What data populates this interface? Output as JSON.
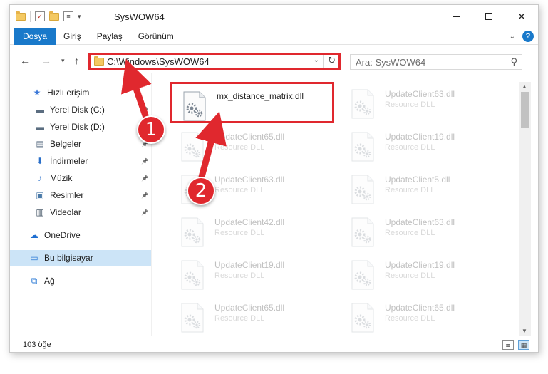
{
  "titlebar": {
    "title": "SysWOW64",
    "minimize": "—",
    "maximize": "☐",
    "close": "✕"
  },
  "ribbon": {
    "tabs": [
      "Dosya",
      "Giriş",
      "Paylaş",
      "Görünüm"
    ]
  },
  "navigation": {
    "back": "←",
    "forward": "→",
    "recent": "▾",
    "up": "↑",
    "address": "C:\\Windows\\SysWOW64",
    "address_chevron": "⌄",
    "refresh": "↻",
    "search_placeholder": "Ara: SysWOW64",
    "search_glyph": "⚲"
  },
  "sidebar": {
    "items": [
      {
        "label": "Hızlı erişim",
        "icon": "star-icon",
        "glyph": "★",
        "color": "#3b78d8"
      },
      {
        "label": "Yerel Disk (C:)",
        "icon": "drive-icon",
        "glyph": "▬",
        "color": "#5b6d80"
      },
      {
        "label": "Yerel Disk (D:)",
        "icon": "drive-icon",
        "glyph": "▬",
        "color": "#5b6d80"
      },
      {
        "label": "Belgeler",
        "icon": "documents-icon",
        "glyph": "▤",
        "color": "#6b7c8f"
      },
      {
        "label": "İndirmeler",
        "icon": "downloads-icon",
        "glyph": "⬇",
        "color": "#2a6fc9"
      },
      {
        "label": "Müzik",
        "icon": "music-icon",
        "glyph": "♪",
        "color": "#2a6fc9"
      },
      {
        "label": "Resimler",
        "icon": "pictures-icon",
        "glyph": "▣",
        "color": "#4a7aa8"
      },
      {
        "label": "Videolar",
        "icon": "videos-icon",
        "glyph": "▥",
        "color": "#4a5a6a"
      },
      {
        "label": "OneDrive",
        "icon": "cloud-icon",
        "glyph": "☁",
        "color": "#1c6dd0"
      },
      {
        "label": "Bu bilgisayar",
        "icon": "computer-icon",
        "glyph": "▭",
        "color": "#2b7ad6"
      },
      {
        "label": "Ağ",
        "icon": "network-icon",
        "glyph": "⧉",
        "color": "#2b7ad6"
      }
    ],
    "pin_glyph": "📌"
  },
  "files": [
    {
      "name": "mx_distance_matrix.dll",
      "desc": ""
    },
    {
      "name": "UpdateClient63.dll",
      "desc": "Resource DLL"
    },
    {
      "name": "UpdateClient65.dll",
      "desc": "Resource DLL"
    },
    {
      "name": "UpdateClient19.dll",
      "desc": "Resource DLL"
    },
    {
      "name": "UpdateClient63.dll",
      "desc": "Resource DLL"
    },
    {
      "name": "UpdateClient5.dll",
      "desc": "Resource DLL"
    },
    {
      "name": "UpdateClient42.dll",
      "desc": "Resource DLL"
    },
    {
      "name": "UpdateClient63.dll",
      "desc": "Resource DLL"
    },
    {
      "name": "UpdateClient19.dll",
      "desc": "Resource DLL"
    },
    {
      "name": "UpdateClient19.dll",
      "desc": "Resource DLL"
    },
    {
      "name": "UpdateClient65.dll",
      "desc": "Resource DLL"
    },
    {
      "name": "UpdateClient65.dll",
      "desc": "Resource DLL"
    }
  ],
  "status": {
    "item_count": "103 öğe"
  },
  "annotations": {
    "step1": "1",
    "step2": "2",
    "color": "#e0282e"
  }
}
